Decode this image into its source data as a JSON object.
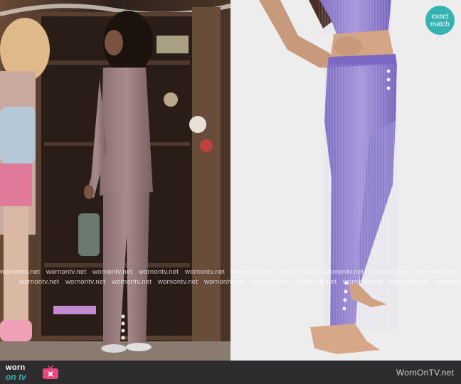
{
  "badge": {
    "line1": "exact",
    "line2": "match"
  },
  "watermark": {
    "text": "wornontv.net",
    "row1": [
      "wornontv.net",
      "wornontv.net",
      "wornontv.net",
      "wornontv.net",
      "wornontv.net",
      "wornontv.net",
      "wornontv.net",
      "wornontv.net",
      "wornontv.net",
      "wornontv.net"
    ],
    "row2": [
      "wornontv.net",
      "wornontv.net",
      "wornontv.net",
      "wornontv.net",
      "wornontv.net",
      "wornontv.net",
      "wornontv.net",
      "wornontv.net",
      "wornontv.net",
      "wornontv.net"
    ]
  },
  "footer": {
    "logo_top": "worn",
    "logo_bottom": "on tv",
    "site_name": "WornOnTV.net"
  },
  "colors": {
    "badge": "#35b3b0",
    "footer_bg": "#2d2d30",
    "pants_purple": "#8a78c8",
    "studio_bg": "#ececec"
  }
}
